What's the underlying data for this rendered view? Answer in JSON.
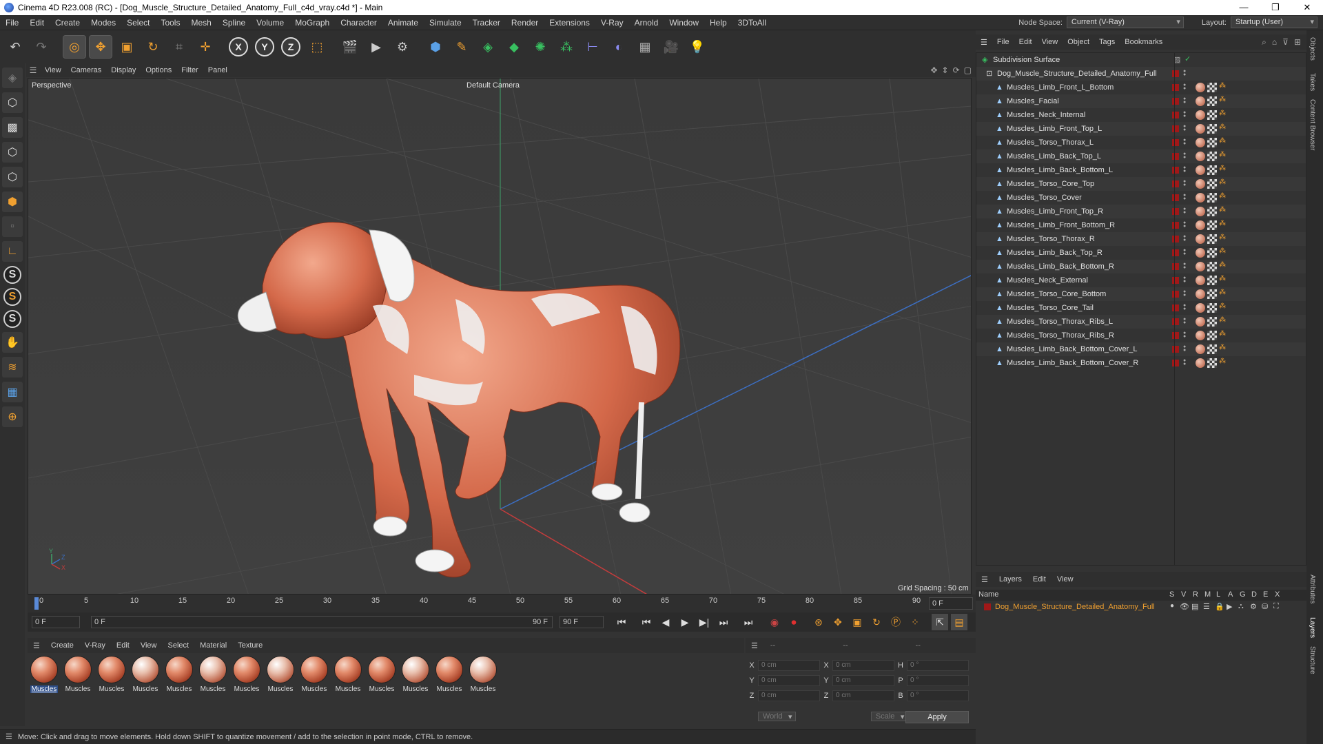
{
  "window": {
    "title": "Cinema 4D R23.008 (RC) - [Dog_Muscle_Structure_Detailed_Anatomy_Full_c4d_vray.c4d *] - Main",
    "minimize": "—",
    "maximize": "❐",
    "close": "✕"
  },
  "menubar": {
    "items": [
      "File",
      "Edit",
      "Create",
      "Modes",
      "Select",
      "Tools",
      "Mesh",
      "Spline",
      "Volume",
      "MoGraph",
      "Character",
      "Animate",
      "Simulate",
      "Tracker",
      "Render",
      "Extensions",
      "V-Ray",
      "Arnold",
      "Window",
      "Help",
      "3DToAll"
    ],
    "node_space_label": "Node Space:",
    "node_space_value": "Current (V-Ray)",
    "layout_label": "Layout:",
    "layout_value": "Startup (User)"
  },
  "viewport": {
    "menu": [
      "View",
      "Cameras",
      "Display",
      "Options",
      "Filter",
      "Panel"
    ],
    "view_name": "Perspective",
    "camera_name": "Default Camera",
    "grid_spacing": "Grid Spacing : 50 cm",
    "axis_y": "Y",
    "axis_z": "Z",
    "axis_x": "X"
  },
  "timeline": {
    "ticks": [
      "0",
      "5",
      "10",
      "15",
      "20",
      "25",
      "30",
      "35",
      "40",
      "45",
      "50",
      "55",
      "60",
      "65",
      "70",
      "75",
      "80",
      "85",
      "90"
    ],
    "current_frame": "0 F",
    "start_frame": "0 F",
    "range_start": "0 F",
    "range_end": "90 F",
    "end_frame": "90 F"
  },
  "materials": {
    "menu": [
      "Create",
      "V-Ray",
      "Edit",
      "View",
      "Select",
      "Material",
      "Texture"
    ],
    "items": [
      "Muscles",
      "Muscles",
      "Muscles",
      "Muscles",
      "Muscles",
      "Muscles",
      "Muscles",
      "Muscles",
      "Muscles",
      "Muscles",
      "Muscles",
      "Muscles",
      "Muscles",
      "Muscles"
    ]
  },
  "coordinates": {
    "header": [
      "--",
      "--",
      "--"
    ],
    "rows": [
      {
        "a": "X",
        "av": "0 cm",
        "b": "X",
        "bv": "0 cm",
        "c": "H",
        "cv": "0 °"
      },
      {
        "a": "Y",
        "av": "0 cm",
        "b": "Y",
        "bv": "0 cm",
        "c": "P",
        "cv": "0 °"
      },
      {
        "a": "Z",
        "av": "0 cm",
        "b": "Z",
        "bv": "0 cm",
        "c": "B",
        "cv": "0 °"
      }
    ],
    "mode1": "World",
    "mode2": "Scale",
    "apply": "Apply"
  },
  "status": {
    "text": "Move: Click and drag to move elements. Hold down SHIFT to quantize movement / add to the selection in point mode, CTRL to remove."
  },
  "objects": {
    "menu": [
      "File",
      "Edit",
      "View",
      "Object",
      "Tags",
      "Bookmarks"
    ],
    "root": "Subdivision Surface",
    "group": "Dog_Muscle_Structure_Detailed_Anatomy_Full",
    "children": [
      "Muscles_Limb_Front_L_Bottom",
      "Muscles_Facial",
      "Muscles_Neck_Internal",
      "Muscles_Limb_Front_Top_L",
      "Muscles_Torso_Thorax_L",
      "Muscles_Limb_Back_Top_L",
      "Muscles_Limb_Back_Bottom_L",
      "Muscles_Torso_Core_Top",
      "Muscles_Torso_Cover",
      "Muscles_Limb_Front_Top_R",
      "Muscles_Limb_Front_Bottom_R",
      "Muscles_Torso_Thorax_R",
      "Muscles_Limb_Back_Top_R",
      "Muscles_Limb_Back_Bottom_R",
      "Muscles_Neck_External",
      "Muscles_Torso_Core_Bottom",
      "Muscles_Torso_Core_Tail",
      "Muscles_Torso_Thorax_Ribs_L",
      "Muscles_Torso_Thorax_Ribs_R",
      "Muscles_Limb_Back_Bottom_Cover_L",
      "Muscles_Limb_Back_Bottom_Cover_R"
    ]
  },
  "layers": {
    "menu": [
      "Layers",
      "Edit",
      "View"
    ],
    "name_header": "Name",
    "flags": [
      "S",
      "V",
      "R",
      "M",
      "L",
      "A",
      "G",
      "D",
      "E",
      "X"
    ],
    "layer_name": "Dog_Muscle_Structure_Detailed_Anatomy_Full"
  },
  "side_tabs": [
    "Objects",
    "Takes",
    "Content Browser",
    "Attributes",
    "Layers",
    "Structure"
  ],
  "colors": {
    "accent_orange": "#f0a030",
    "layer_red": "#a01818",
    "selection_blue": "#2e4e88"
  }
}
